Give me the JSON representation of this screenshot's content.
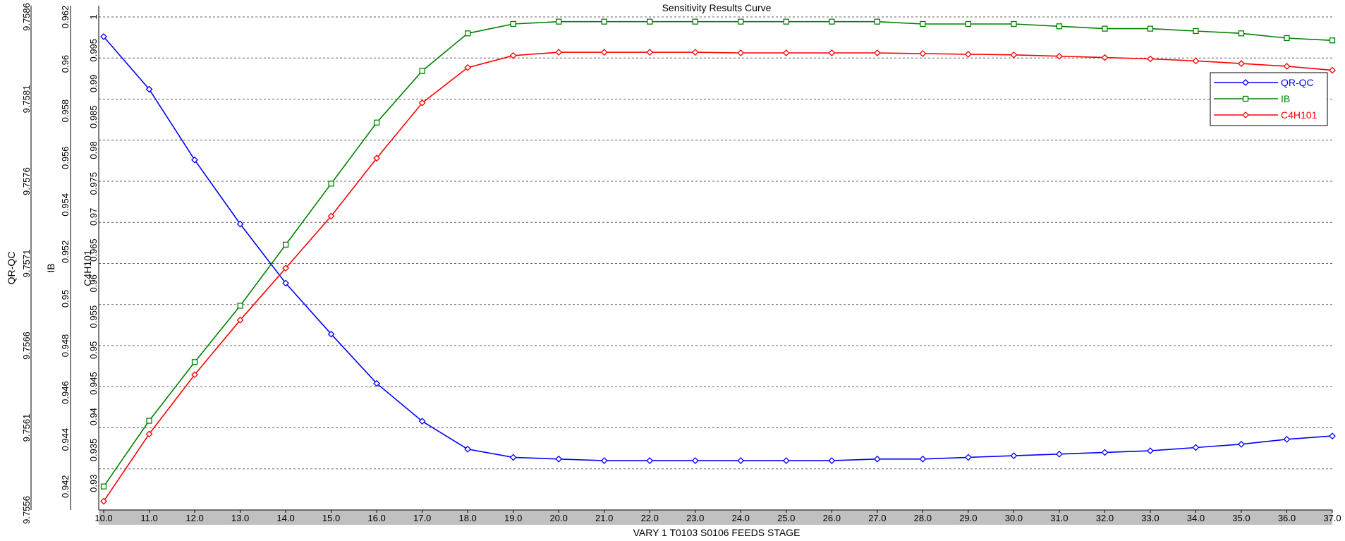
{
  "chart_data": {
    "type": "line",
    "title": "Sensitivity Results Curve",
    "xlabel": "VARY   1 T0103 S0106 FEEDS STAGE",
    "x": [
      10,
      11,
      12,
      13,
      14,
      15,
      16,
      17,
      18,
      19,
      20,
      21,
      22,
      23,
      24,
      25,
      26,
      27,
      28,
      29,
      30,
      31,
      32,
      33,
      34,
      35,
      36,
      37
    ],
    "xlim": [
      10,
      37
    ],
    "x_tick_labels": [
      "10.0",
      "11.0",
      "12.0",
      "13.0",
      "14.0",
      "15.0",
      "16.0",
      "17.0",
      "18.0",
      "19.0",
      "20.0",
      "21.0",
      "22.0",
      "23.0",
      "24.0",
      "25.0",
      "26.0",
      "27.0",
      "28.0",
      "29.0",
      "30.0",
      "31.0",
      "32.0",
      "33.0",
      "34.0",
      "35.0",
      "36.0",
      "37.0"
    ],
    "grid": true,
    "legend_position": "top-right",
    "series": [
      {
        "name": "QR-QC",
        "color": "#0000ff",
        "marker": "diamond",
        "ylabel": "QR-QC",
        "ylim": [
          9.7556,
          9.7586
        ],
        "y_tick_labels": [
          "9.7556",
          "9.7561",
          "9.7566",
          "9.7571",
          "9.7576",
          "9.7581",
          "9.7586"
        ],
        "values": [
          9.75848,
          9.75816,
          9.75773,
          9.75734,
          9.75698,
          9.75667,
          9.75637,
          9.75614,
          9.75597,
          9.75592,
          9.75591,
          9.7559,
          9.7559,
          9.7559,
          9.7559,
          9.7559,
          9.7559,
          9.75591,
          9.75591,
          9.75592,
          9.75593,
          9.75594,
          9.75595,
          9.75596,
          9.75598,
          9.756,
          9.75603,
          9.75605
        ]
      },
      {
        "name": "IB",
        "color": "#008000",
        "marker": "square",
        "ylabel": "IB",
        "ylim": [
          0.941,
          0.962
        ],
        "y_tick_labels": [
          "0.942",
          "0.944",
          "0.946",
          "0.948",
          "0.95",
          "0.952",
          "0.954",
          "0.956",
          "0.958",
          "0.96",
          "0.962"
        ],
        "values": [
          0.942,
          0.9448,
          0.9473,
          0.9497,
          0.9523,
          0.9549,
          0.9575,
          0.9597,
          0.9613,
          0.9617,
          0.9618,
          0.9618,
          0.9618,
          0.9618,
          0.9618,
          0.9618,
          0.9618,
          0.9618,
          0.9617,
          0.9617,
          0.9617,
          0.9616,
          0.9615,
          0.9615,
          0.9614,
          0.9613,
          0.9611,
          0.961
        ]
      },
      {
        "name": "C4H101",
        "color": "#ff0000",
        "marker": "diamond",
        "ylabel": "C4H101",
        "ylim": [
          0.926,
          1.0
        ],
        "y_tick_labels": [
          "0.93",
          "0.935",
          "0.94",
          "0.945",
          "0.95",
          "0.955",
          "0.96",
          "0.965",
          "0.97",
          "0.975",
          "0.98",
          "0.985",
          "0.99",
          "0.995",
          "1"
        ],
        "values": [
          0.9273,
          0.9374,
          0.9463,
          0.9545,
          0.9623,
          0.9701,
          0.9788,
          0.9871,
          0.9924,
          0.9942,
          0.9947,
          0.9947,
          0.9947,
          0.9947,
          0.9946,
          0.9946,
          0.9946,
          0.9946,
          0.9945,
          0.9944,
          0.9943,
          0.9941,
          0.9939,
          0.9937,
          0.9934,
          0.993,
          0.9926,
          0.992
        ]
      }
    ]
  }
}
